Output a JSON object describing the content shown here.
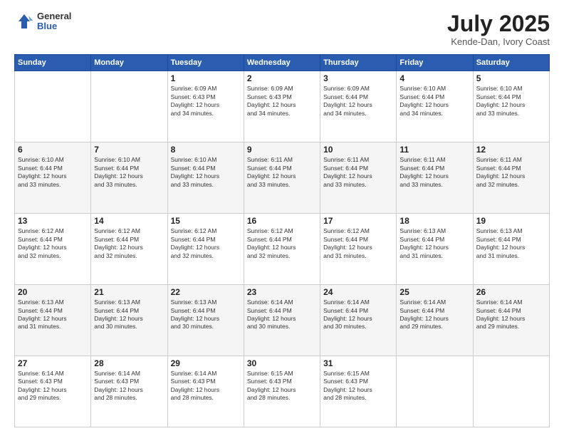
{
  "logo": {
    "general": "General",
    "blue": "Blue"
  },
  "header": {
    "month_year": "July 2025",
    "location": "Kende-Dan, Ivory Coast"
  },
  "days_of_week": [
    "Sunday",
    "Monday",
    "Tuesday",
    "Wednesday",
    "Thursday",
    "Friday",
    "Saturday"
  ],
  "weeks": [
    [
      {
        "day": "",
        "info": ""
      },
      {
        "day": "",
        "info": ""
      },
      {
        "day": "1",
        "info": "Sunrise: 6:09 AM\nSunset: 6:43 PM\nDaylight: 12 hours\nand 34 minutes."
      },
      {
        "day": "2",
        "info": "Sunrise: 6:09 AM\nSunset: 6:43 PM\nDaylight: 12 hours\nand 34 minutes."
      },
      {
        "day": "3",
        "info": "Sunrise: 6:09 AM\nSunset: 6:44 PM\nDaylight: 12 hours\nand 34 minutes."
      },
      {
        "day": "4",
        "info": "Sunrise: 6:10 AM\nSunset: 6:44 PM\nDaylight: 12 hours\nand 34 minutes."
      },
      {
        "day": "5",
        "info": "Sunrise: 6:10 AM\nSunset: 6:44 PM\nDaylight: 12 hours\nand 33 minutes."
      }
    ],
    [
      {
        "day": "6",
        "info": "Sunrise: 6:10 AM\nSunset: 6:44 PM\nDaylight: 12 hours\nand 33 minutes."
      },
      {
        "day": "7",
        "info": "Sunrise: 6:10 AM\nSunset: 6:44 PM\nDaylight: 12 hours\nand 33 minutes."
      },
      {
        "day": "8",
        "info": "Sunrise: 6:10 AM\nSunset: 6:44 PM\nDaylight: 12 hours\nand 33 minutes."
      },
      {
        "day": "9",
        "info": "Sunrise: 6:11 AM\nSunset: 6:44 PM\nDaylight: 12 hours\nand 33 minutes."
      },
      {
        "day": "10",
        "info": "Sunrise: 6:11 AM\nSunset: 6:44 PM\nDaylight: 12 hours\nand 33 minutes."
      },
      {
        "day": "11",
        "info": "Sunrise: 6:11 AM\nSunset: 6:44 PM\nDaylight: 12 hours\nand 33 minutes."
      },
      {
        "day": "12",
        "info": "Sunrise: 6:11 AM\nSunset: 6:44 PM\nDaylight: 12 hours\nand 32 minutes."
      }
    ],
    [
      {
        "day": "13",
        "info": "Sunrise: 6:12 AM\nSunset: 6:44 PM\nDaylight: 12 hours\nand 32 minutes."
      },
      {
        "day": "14",
        "info": "Sunrise: 6:12 AM\nSunset: 6:44 PM\nDaylight: 12 hours\nand 32 minutes."
      },
      {
        "day": "15",
        "info": "Sunrise: 6:12 AM\nSunset: 6:44 PM\nDaylight: 12 hours\nand 32 minutes."
      },
      {
        "day": "16",
        "info": "Sunrise: 6:12 AM\nSunset: 6:44 PM\nDaylight: 12 hours\nand 32 minutes."
      },
      {
        "day": "17",
        "info": "Sunrise: 6:12 AM\nSunset: 6:44 PM\nDaylight: 12 hours\nand 31 minutes."
      },
      {
        "day": "18",
        "info": "Sunrise: 6:13 AM\nSunset: 6:44 PM\nDaylight: 12 hours\nand 31 minutes."
      },
      {
        "day": "19",
        "info": "Sunrise: 6:13 AM\nSunset: 6:44 PM\nDaylight: 12 hours\nand 31 minutes."
      }
    ],
    [
      {
        "day": "20",
        "info": "Sunrise: 6:13 AM\nSunset: 6:44 PM\nDaylight: 12 hours\nand 31 minutes."
      },
      {
        "day": "21",
        "info": "Sunrise: 6:13 AM\nSunset: 6:44 PM\nDaylight: 12 hours\nand 30 minutes."
      },
      {
        "day": "22",
        "info": "Sunrise: 6:13 AM\nSunset: 6:44 PM\nDaylight: 12 hours\nand 30 minutes."
      },
      {
        "day": "23",
        "info": "Sunrise: 6:14 AM\nSunset: 6:44 PM\nDaylight: 12 hours\nand 30 minutes."
      },
      {
        "day": "24",
        "info": "Sunrise: 6:14 AM\nSunset: 6:44 PM\nDaylight: 12 hours\nand 30 minutes."
      },
      {
        "day": "25",
        "info": "Sunrise: 6:14 AM\nSunset: 6:44 PM\nDaylight: 12 hours\nand 29 minutes."
      },
      {
        "day": "26",
        "info": "Sunrise: 6:14 AM\nSunset: 6:44 PM\nDaylight: 12 hours\nand 29 minutes."
      }
    ],
    [
      {
        "day": "27",
        "info": "Sunrise: 6:14 AM\nSunset: 6:43 PM\nDaylight: 12 hours\nand 29 minutes."
      },
      {
        "day": "28",
        "info": "Sunrise: 6:14 AM\nSunset: 6:43 PM\nDaylight: 12 hours\nand 28 minutes."
      },
      {
        "day": "29",
        "info": "Sunrise: 6:14 AM\nSunset: 6:43 PM\nDaylight: 12 hours\nand 28 minutes."
      },
      {
        "day": "30",
        "info": "Sunrise: 6:15 AM\nSunset: 6:43 PM\nDaylight: 12 hours\nand 28 minutes."
      },
      {
        "day": "31",
        "info": "Sunrise: 6:15 AM\nSunset: 6:43 PM\nDaylight: 12 hours\nand 28 minutes."
      },
      {
        "day": "",
        "info": ""
      },
      {
        "day": "",
        "info": ""
      }
    ]
  ]
}
